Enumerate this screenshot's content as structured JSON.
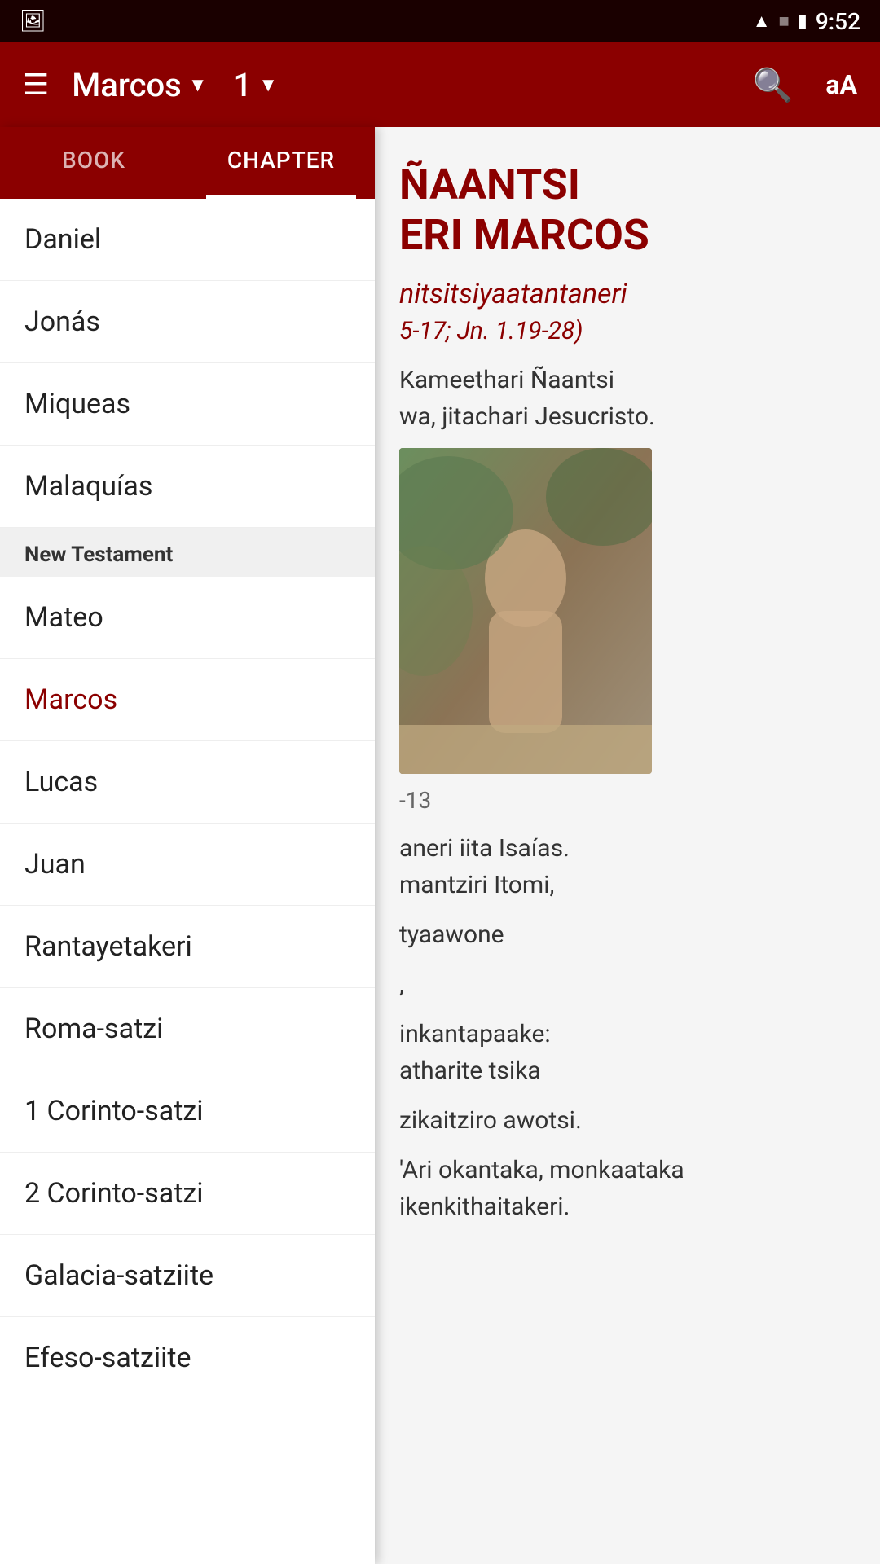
{
  "statusBar": {
    "time": "9:52",
    "icons": [
      "wifi",
      "signal-off",
      "battery"
    ]
  },
  "toolbar": {
    "menuIcon": "≡",
    "bookTitle": "Marcos",
    "chapterNum": "1",
    "searchIcon": "search",
    "textSizeIcon": "aA"
  },
  "tabs": {
    "items": [
      {
        "id": "book",
        "label": "BOOK",
        "active": false
      },
      {
        "id": "chapter",
        "label": "CHAPTER",
        "active": true
      }
    ]
  },
  "bookList": {
    "items": [
      {
        "id": "daniel",
        "label": "Daniel",
        "section": null
      },
      {
        "id": "jonas",
        "label": "Jonás",
        "section": null
      },
      {
        "id": "miqueas",
        "label": "Miqueas",
        "section": null
      },
      {
        "id": "malaquias",
        "label": "Malaquías",
        "section": null
      },
      {
        "id": "new-testament-header",
        "label": "New Testament",
        "section": "header"
      },
      {
        "id": "mateo",
        "label": "Mateo",
        "section": null
      },
      {
        "id": "marcos",
        "label": "Marcos",
        "section": null,
        "active": true
      },
      {
        "id": "lucas",
        "label": "Lucas",
        "section": null
      },
      {
        "id": "juan",
        "label": "Juan",
        "section": null
      },
      {
        "id": "rantayetakeri",
        "label": "Rantayetakeri",
        "section": null
      },
      {
        "id": "roma-satzi",
        "label": "Roma-satzi",
        "section": null
      },
      {
        "id": "1-corinto-satzi",
        "label": "1 Corinto-satzi",
        "section": null
      },
      {
        "id": "2-corinto-satzi",
        "label": "2 Corinto-satzi",
        "section": null
      },
      {
        "id": "galacia-satziite",
        "label": "Galacia-satziite",
        "section": null
      },
      {
        "id": "efeso-satziite",
        "label": "Efeso-satziite",
        "section": null
      }
    ]
  },
  "content": {
    "titleLine1": "ÑAANTSI",
    "titleLine2": "ERI MARCOS",
    "subtitle": "nitsitsiyaatantaneri",
    "ref": "5-17; Jn. 1.19-28)",
    "text1": "Kameethari Ñaantsi",
    "text2": "wa, jitachari Jesucristo.",
    "imageCaption": "-13",
    "text3": "aneri iita Isaías.",
    "text4": "mantziri Itomi,",
    "text5": "tyaawone",
    "text6": ",",
    "text7": "inkantapaake:",
    "text8": "atharite tsika",
    "text9": "zikaitziro awotsi.",
    "text10": "'Ari okantaka, monkaataka ikenkithaitakeri."
  }
}
